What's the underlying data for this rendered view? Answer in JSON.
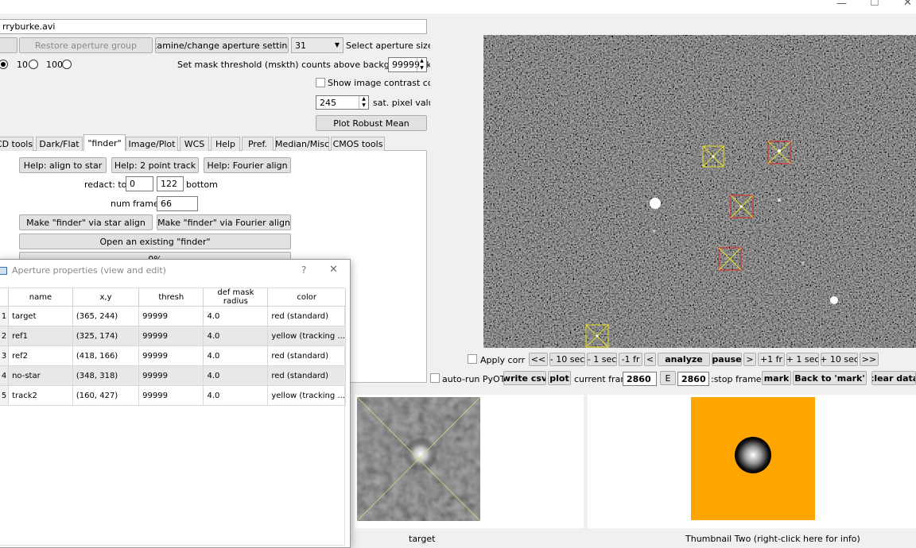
{
  "window": {
    "file_path": "rryburke.avi",
    "controls": {
      "minimize": "—",
      "maximize": "☐",
      "close": "✕"
    }
  },
  "top": {
    "restore_group": "Restore aperture group",
    "examine_settings": "Examine/change aperture settings",
    "aperture_size_value": "31",
    "aperture_size_label": "Select aperture size",
    "radio_10": "10",
    "radio_100": "100",
    "mask_threshold_label": "Set mask threshold (mskth) counts above background (bkavg)",
    "mask_threshold_value": "99999",
    "show_contrast_label": "Show image contrast control",
    "sat_value": "245",
    "sat_label": "sat. pixel value",
    "plot_robust_mean": "Plot Robust Mean"
  },
  "tabs": [
    "CD tools",
    "Dark/Flat",
    "\"finder\"",
    "Image/Plot",
    "WCS",
    "Help",
    "Pref.",
    "Median/Misc",
    "CMOS tools"
  ],
  "finder": {
    "help_align": "Help: align to star",
    "help_two_point": "Help: 2 point track",
    "help_fourier": "Help: Fourier align",
    "redact_top_label": "redact: top",
    "redact_top_value": "0",
    "redact_bottom_value": "122",
    "redact_bottom_label": "bottom",
    "num_frames_label": "num frames:",
    "num_frames_value": "66",
    "make_star": "Make \"finder\" via star align",
    "make_fourier": "Make \"finder\" via Fourier align",
    "open_existing": "Open an existing  \"finder\"",
    "progress_text": "0%"
  },
  "dialog": {
    "title": "Aperture properties (view and edit)",
    "help": "?",
    "close": "✕",
    "columns": [
      "name",
      "x,y",
      "thresh",
      "def mask radius",
      "color"
    ],
    "rows": [
      {
        "num": "1",
        "name": "target",
        "xy": "(365, 244)",
        "thresh": "99999",
        "radius": "4.0",
        "color": "red (standard)"
      },
      {
        "num": "2",
        "name": "ref1",
        "xy": "(325, 174)",
        "thresh": "99999",
        "radius": "4.0",
        "color": "yellow (tracking ..."
      },
      {
        "num": "3",
        "name": "ref2",
        "xy": "(418, 166)",
        "thresh": "99999",
        "radius": "4.0",
        "color": "red (standard)"
      },
      {
        "num": "4",
        "name": "no-star",
        "xy": "(348, 318)",
        "thresh": "99999",
        "radius": "4.0",
        "color": "red (standard)"
      },
      {
        "num": "5",
        "name": "track2",
        "xy": "(160, 427)",
        "thresh": "99999",
        "radius": "4.0",
        "color": "yellow (tracking ..."
      }
    ]
  },
  "playback": {
    "apply_corr": "Apply corr",
    "rew_full": "<<",
    "minus10": "- 10 sec",
    "minus1": "- 1 sec",
    "minus1fr": "-1 fr",
    "back": "<",
    "analyze": "analyze",
    "pause": "pause",
    "fwd": ">",
    "plus1fr": "+1 fr",
    "plus1": "+ 1 sec",
    "plus10": "+ 10 sec",
    "fwd_full": ">>",
    "auto_run": "auto-run PyOTE",
    "write_csv": "write csv",
    "plot": "plot",
    "current_frame_label": "current frame:",
    "current_frame_value": "2860",
    "e_button": "E",
    "stop_frame_value": "2860",
    "stop_frame_label": ":stop frame",
    "mark": "mark",
    "back_to_mark": "Back to 'mark'",
    "clear_data": "clear data"
  },
  "thumbnails": {
    "one_label": "target",
    "two_label": "Thumbnail Two (right-click here for info)"
  },
  "colors": {
    "aperture_red": "#e02020",
    "aperture_yellow": "#e8e020",
    "thumb_two_bg": "#ffa500"
  }
}
